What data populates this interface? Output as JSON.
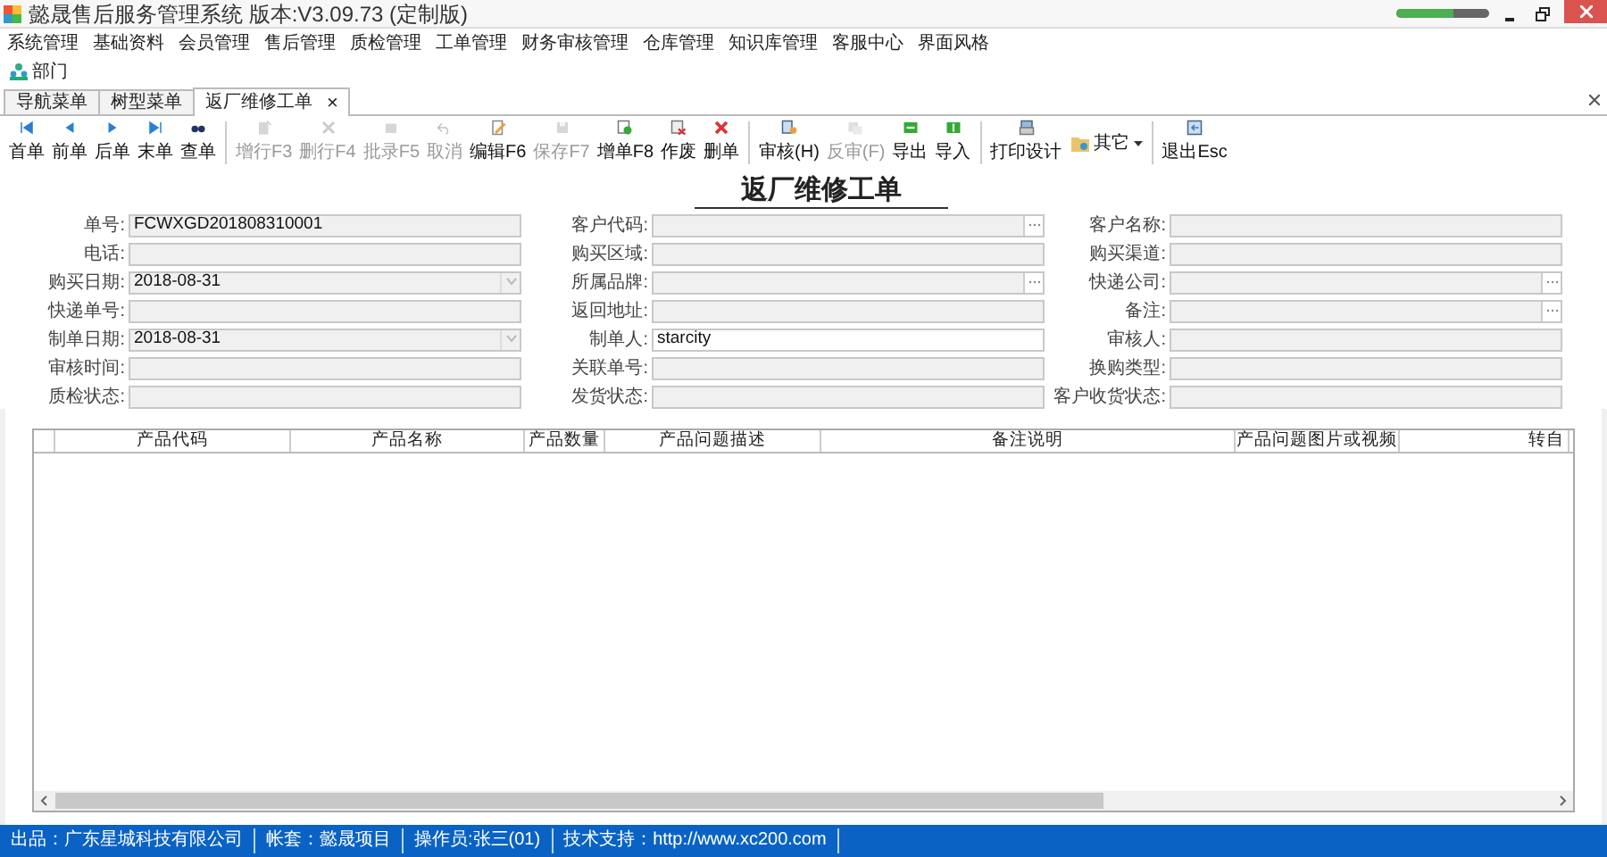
{
  "window": {
    "title": "懿晟售后服务管理系统 版本:V3.09.73 (定制版)",
    "meter": {
      "level": 0.62
    }
  },
  "menu": [
    "系统管理",
    "基础资料",
    "会员管理",
    "售后管理",
    "质检管理",
    "工单管理",
    "财务审核管理",
    "仓库管理",
    "知识库管理",
    "客服中心",
    "界面风格"
  ],
  "quick_link": "部门",
  "tabs": [
    {
      "label": "导航菜单",
      "selected": false,
      "closable": false
    },
    {
      "label": "树型菜单",
      "selected": false,
      "closable": false
    },
    {
      "label": "返厂维修工单",
      "selected": true,
      "closable": true
    }
  ],
  "tab_close": "×",
  "toolbar": [
    [
      {
        "label": "首单",
        "disabled": false
      },
      {
        "label": "前单",
        "disabled": false
      },
      {
        "label": "后单",
        "disabled": false
      },
      {
        "label": "末单",
        "disabled": false
      },
      {
        "label": "查单",
        "disabled": false
      }
    ],
    [
      {
        "label": "增行F3",
        "disabled": true
      },
      {
        "label": "删行F4",
        "disabled": true
      },
      {
        "label": "批录F5",
        "disabled": true
      },
      {
        "label": "取消",
        "disabled": true
      },
      {
        "label": "编辑F6",
        "disabled": false
      },
      {
        "label": "保存F7",
        "disabled": true
      },
      {
        "label": "增单F8",
        "disabled": false
      },
      {
        "label": "作废",
        "disabled": false
      },
      {
        "label": "删单",
        "disabled": false
      }
    ],
    [
      {
        "label": "审核(H)",
        "disabled": false
      },
      {
        "label": "反审(F)",
        "disabled": true
      },
      {
        "label": "导出",
        "disabled": false
      },
      {
        "label": "导入",
        "disabled": false
      }
    ],
    [
      {
        "label": "打印设计",
        "disabled": false
      },
      {
        "label": "其它",
        "disabled": false,
        "kind": "dropdown"
      }
    ],
    [
      {
        "label": "退出Esc",
        "disabled": false
      }
    ]
  ],
  "form": {
    "title": "返厂维修工单",
    "rows": [
      [
        {
          "label": "单号:",
          "value": "FCWXGD201808310001",
          "kind": "text"
        },
        {
          "label": "客户代码:",
          "kind": "lookup"
        },
        {
          "label": "客户名称:",
          "kind": "text"
        }
      ],
      [
        {
          "label": "电话:",
          "kind": "text"
        },
        {
          "label": "购买区域:",
          "kind": "text"
        },
        {
          "label": "购买渠道:",
          "kind": "text"
        }
      ],
      [
        {
          "label": "购买日期:",
          "value": "2018-08-31",
          "kind": "date"
        },
        {
          "label": "所属品牌:",
          "kind": "lookup"
        },
        {
          "label": "快递公司:",
          "kind": "lookup"
        }
      ],
      [
        {
          "label": "快递单号:",
          "kind": "text"
        },
        {
          "label": "返回地址:",
          "kind": "text"
        },
        {
          "label": "备注:",
          "kind": "lookup"
        }
      ],
      [
        {
          "label": "制单日期:",
          "value": "2018-08-31",
          "kind": "date"
        },
        {
          "label": "制单人:",
          "value": "starcity",
          "kind": "white"
        },
        {
          "label": "审核人:",
          "kind": "text"
        }
      ],
      [
        {
          "label": "审核时间:",
          "kind": "text"
        },
        {
          "label": "关联单号:",
          "kind": "text"
        },
        {
          "label": "换购类型:",
          "kind": "text"
        }
      ],
      [
        {
          "label": "质检状态:",
          "kind": "text"
        },
        {
          "label": "发货状态:",
          "kind": "text"
        },
        {
          "label": "客户收货状态:",
          "kind": "text"
        }
      ]
    ]
  },
  "table": {
    "columns": [
      "产品代码",
      "产品名称",
      "产品数量",
      "产品问题描述",
      "备注说明",
      "产品问题图片或视频",
      "转自"
    ]
  },
  "status_bar": [
    "出品：广东星城科技有限公司",
    "帐套：懿晟项目",
    "操作员:张三(01)",
    "技术支持：http://www.xc200.com"
  ]
}
